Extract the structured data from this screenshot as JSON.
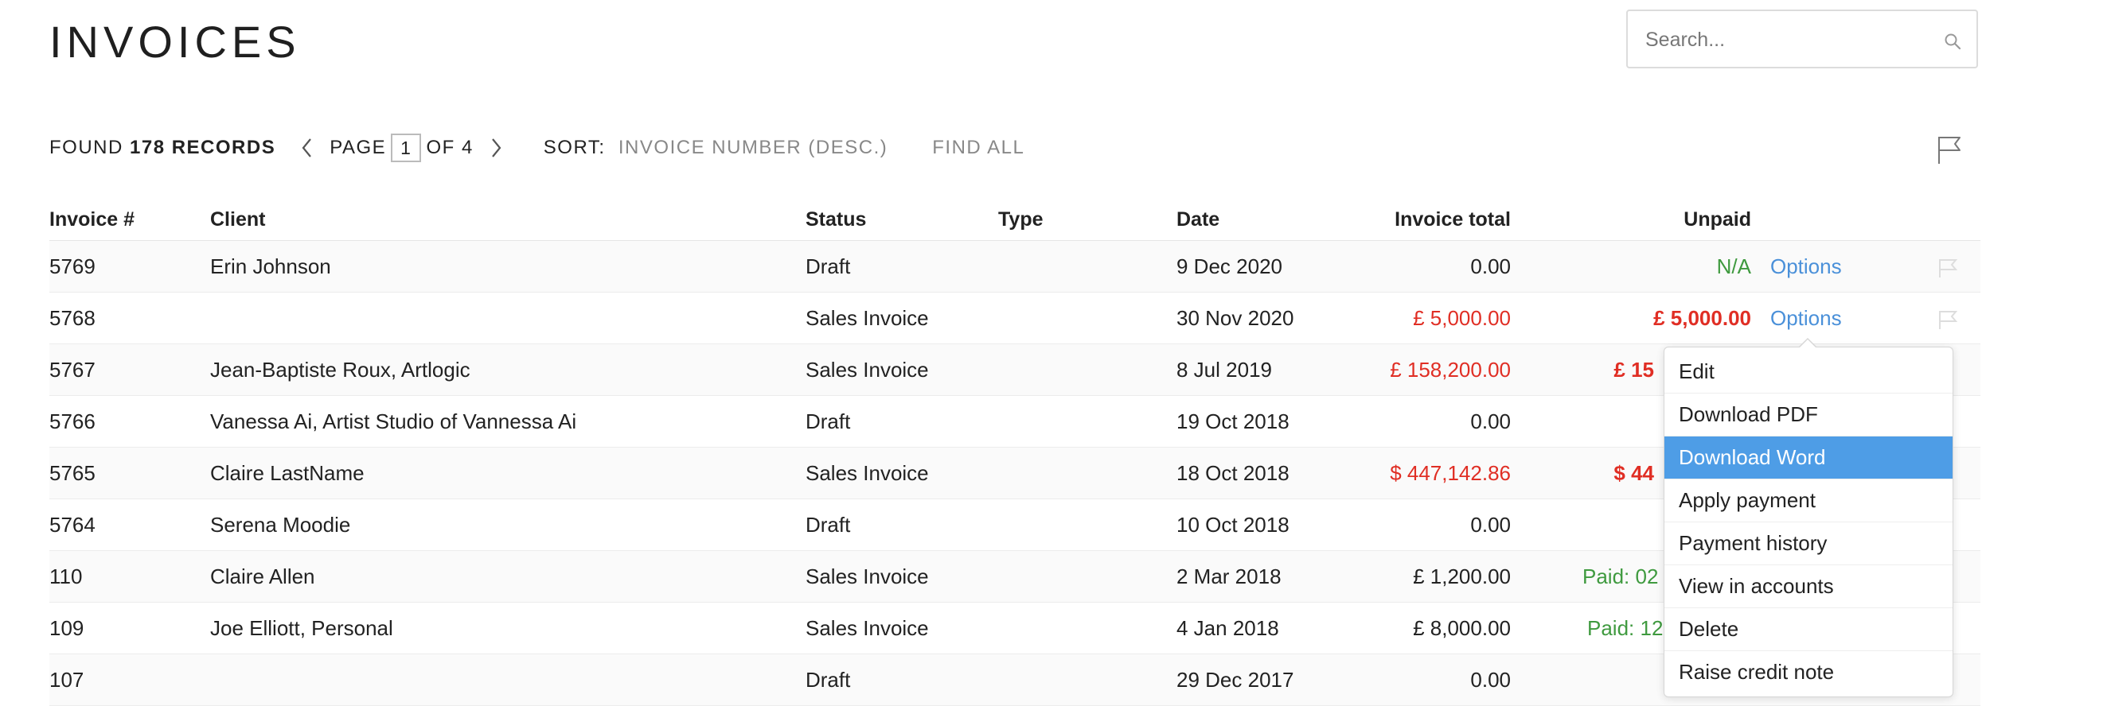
{
  "page": {
    "title": "INVOICES"
  },
  "search": {
    "placeholder": "Search..."
  },
  "toolbar": {
    "found_prefix": "FOUND",
    "found_count": "178 RECORDS",
    "page_label": "PAGE",
    "page_current": "1",
    "page_of": "OF 4",
    "sort_label": "SORT:",
    "sort_value": "INVOICE NUMBER (DESC.)",
    "find_all": "FIND ALL"
  },
  "table": {
    "headers": {
      "invoice": "Invoice #",
      "client": "Client",
      "status": "Status",
      "type": "Type",
      "date": "Date",
      "total": "Invoice total",
      "unpaid": "Unpaid"
    },
    "rows": [
      {
        "invoice": "5769",
        "client": "Erin Johnson",
        "status": "Draft",
        "type": "",
        "date": "9 Dec 2020",
        "total": "0.00",
        "unpaid": "N/A",
        "options": "Options"
      },
      {
        "invoice": "5768",
        "client": "",
        "status": "Sales Invoice",
        "type": "",
        "date": "30 Nov 2020",
        "total": "£ 5,000.00",
        "unpaid": "£ 5,000.00",
        "options": "Options"
      },
      {
        "invoice": "5767",
        "client": "Jean-Baptiste Roux, Artlogic",
        "status": "Sales Invoice",
        "type": "",
        "date": "8 Jul 2019",
        "total": "£ 158,200.00",
        "unpaid": "£ 15"
      },
      {
        "invoice": "5766",
        "client": "Vanessa Ai, Artist Studio of Vannessa Ai",
        "status": "Draft",
        "type": "",
        "date": "19 Oct 2018",
        "total": "0.00",
        "unpaid": ""
      },
      {
        "invoice": "5765",
        "client": "Claire LastName",
        "status": "Sales Invoice",
        "type": "",
        "date": "18 Oct 2018",
        "total": "$ 447,142.86",
        "unpaid": "$ 44"
      },
      {
        "invoice": "5764",
        "client": "Serena Moodie",
        "status": "Draft",
        "type": "",
        "date": "10 Oct 2018",
        "total": "0.00",
        "unpaid": ""
      },
      {
        "invoice": "110",
        "client": "Claire Allen",
        "status": "Sales Invoice",
        "type": "",
        "date": "2 Mar 2018",
        "total": "£ 1,200.00",
        "unpaid": "Paid: 02"
      },
      {
        "invoice": "109",
        "client": "Joe Elliott, Personal",
        "status": "Sales Invoice",
        "type": "",
        "date": "4 Jan 2018",
        "total": "£ 8,000.00",
        "unpaid": "Paid: 12"
      },
      {
        "invoice": "107",
        "client": "",
        "status": "Draft",
        "type": "",
        "date": "29 Dec 2017",
        "total": "0.00",
        "unpaid": ""
      }
    ]
  },
  "dropdown": {
    "items": [
      "Edit",
      "Download PDF",
      "Download Word",
      "Apply payment",
      "Payment history",
      "View in accounts",
      "Delete",
      "Raise credit note"
    ],
    "active": "Download Word"
  },
  "colors": {
    "accent": "#4e9de6",
    "link": "#4a90d9",
    "negative": "#e02e24",
    "positive": "#3f9a3f"
  },
  "icons": [
    "search-icon",
    "chevron-left-icon",
    "chevron-right-icon",
    "flag-icon"
  ]
}
